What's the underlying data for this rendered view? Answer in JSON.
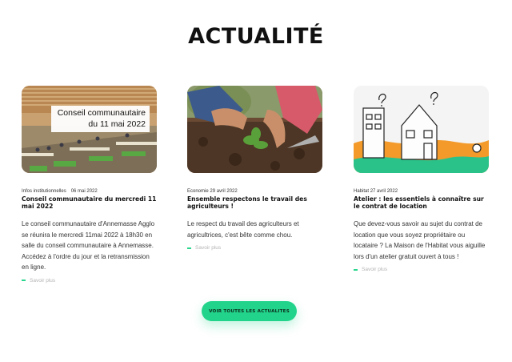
{
  "section": {
    "title": "ACTUALITÉ"
  },
  "cards": [
    {
      "category": "Infos institutionnelles",
      "date": "06 mai 2022",
      "title": "Conseil communautaire du mercredi 11 mai 2022",
      "excerpt": "Le conseil communautaire d'Annemasse Agglo se réunira le mercredi 11mai 2022 à 18h30 en salle du conseil communautaire à Annemasse. Accédez à l'ordre du jour et la retransmission en ligne.",
      "more_label": "Savoir plus",
      "image_caption_line1": "Conseil communautaire",
      "image_caption_line2": "du 11 mai 2022"
    },
    {
      "category": "Economie",
      "date": "29 avril 2022",
      "title": "Ensemble respectons le travail des agriculteurs !",
      "excerpt": "Le respect du travail des agriculteurs et agricultrices, c'est bête comme chou.",
      "more_label": "Savoir plus"
    },
    {
      "category": "Habitat",
      "date": "27 avril 2022",
      "title": "Atelier : les essentiels à connaître sur le contrat de location",
      "excerpt": "Que devez-vous savoir au sujet du contrat de location que vous soyez propriétaire ou locataire ? La Maison de l'Habitat vous aiguille lors d'un atelier gratuit ouvert à tous !",
      "more_label": "Savoir plus"
    }
  ],
  "cta": {
    "label": "VOIR TOUTES LES ACTUALITES"
  },
  "colors": {
    "accent": "#22d48b",
    "muted": "#b4b4b4",
    "orange": "#f39a2b"
  }
}
